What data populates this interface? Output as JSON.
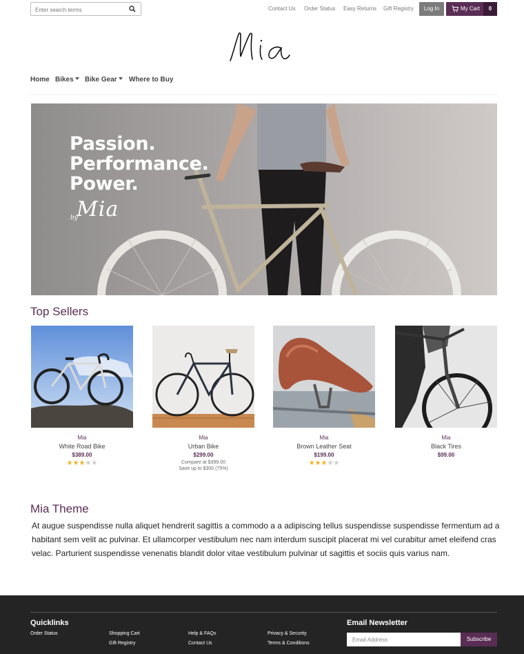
{
  "search": {
    "placeholder": "Enter search terms"
  },
  "top_links": [
    "Contact Us",
    "Order Status",
    "Easy Returns",
    "Gift Registry"
  ],
  "login_label": "Log In",
  "cart": {
    "label": "My Cart",
    "count": "0"
  },
  "logo_text": "Mia",
  "nav": [
    "Home",
    "Bikes",
    "Bike Gear",
    "Where to Buy"
  ],
  "hero": {
    "lines": [
      "Passion.",
      "Performance.",
      "Power."
    ],
    "by": "by",
    "brand": "Mia"
  },
  "top_sellers_title": "Top Sellers",
  "products": [
    {
      "brand": "Mia",
      "name": "White Road Bike",
      "price": "$389.00",
      "rating": 3
    },
    {
      "brand": "Mia",
      "name": "Urban Bike",
      "price": "$299.00",
      "compare": "Compare at $399.00",
      "save": "Save up to $300 (75%)"
    },
    {
      "brand": "Mia",
      "name": "Brown Leather Seat",
      "price": "$199.00",
      "rating": 3
    },
    {
      "brand": "Mia",
      "name": "Black Tires",
      "price": "$99.00"
    }
  ],
  "theme": {
    "title": "Mia Theme",
    "body": "At augue suspendisse nulla aliquet hendrerit sagittis a commodo a a adipiscing tellus suspendisse suspendisse fermentum ad a habitant sem velit ac pulvinar. Et ullamcorper vestibulum nec nam interdum suscipit placerat mi vel curabitur amet eleifend cras velac. Parturient suspendisse venenatis blandit dolor vitae vestibulum pulvinar ut sagittis et sociis quis varius nam."
  },
  "footer": {
    "quicklinks_title": "Quicklinks",
    "links": [
      "Order Status",
      "Shopping Cart",
      "Gift Registry",
      "Help & FAQs",
      "Contact Us",
      "Privacy & Security",
      "Terms & Conditions"
    ],
    "newsletter_title": "Email Newsletter",
    "email_placeholder": "Email Address",
    "subscribe_label": "Subscribe"
  },
  "colors": {
    "accent": "#5a2d55",
    "accent_dark": "#3a1a37",
    "footer_bg": "#242424",
    "star": "#f0b429"
  },
  "icons": {
    "search": "search-icon",
    "cart": "cart-icon",
    "caret": "caret-down-icon"
  }
}
